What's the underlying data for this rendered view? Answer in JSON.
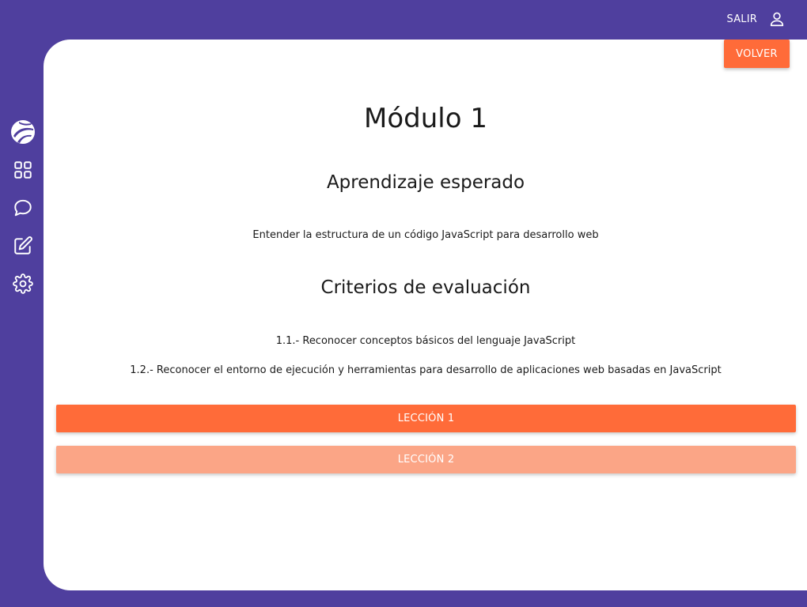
{
  "header": {
    "logout_label": "SALIR",
    "logout_icon": "user-icon"
  },
  "sidebar": {
    "items": [
      {
        "name": "logo",
        "icon": "logo-icon"
      },
      {
        "name": "dashboard",
        "icon": "grid-icon"
      },
      {
        "name": "chat",
        "icon": "chat-bubble-icon"
      },
      {
        "name": "edit",
        "icon": "edit-icon"
      },
      {
        "name": "settings",
        "icon": "gear-icon"
      }
    ]
  },
  "main": {
    "back_label": "VOLVER",
    "module_title": "Módulo 1",
    "learning": {
      "title": "Aprendizaje esperado",
      "text": "Entender la estructura de un código JavaScript para desarrollo web"
    },
    "criteria": {
      "title": "Criterios de evaluación",
      "items": [
        "1.1.- Reconocer conceptos básicos del lenguaje JavaScript",
        "1.2.- Reconocer el entorno de ejecución y herramientas para desarrollo de aplicaciones web basadas en JavaScript"
      ]
    },
    "lessons": [
      {
        "label": "LECCIÓN 1"
      },
      {
        "label": "LECCIÓN 2"
      }
    ]
  },
  "colors": {
    "background": "#4f3f9e",
    "accent": "#ff6b39",
    "accent_light": "#fba586",
    "card": "#ffffff"
  }
}
